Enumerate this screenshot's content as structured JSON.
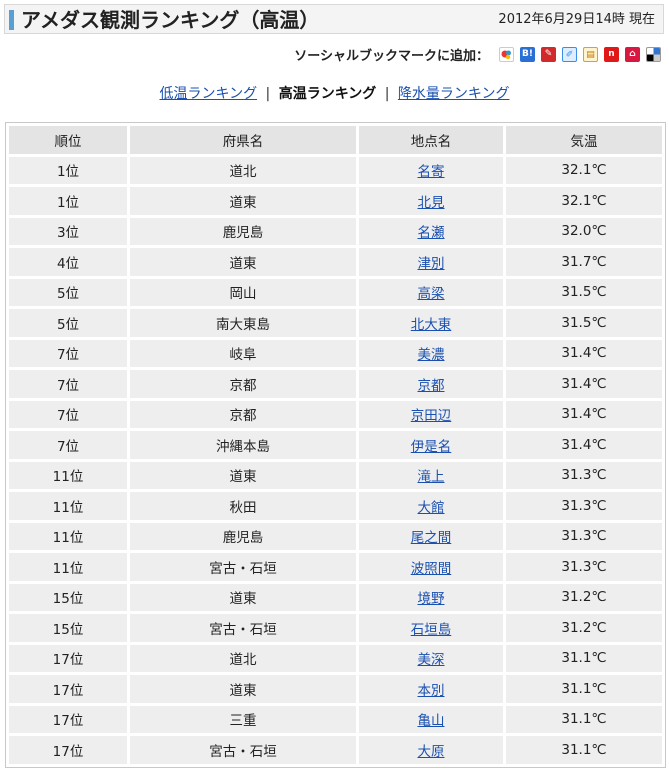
{
  "page": {
    "title": "アメダス観測ランキング（高温）",
    "timestamp": "2012年6月29日14時 現在"
  },
  "social": {
    "label": "ソーシャルブックマークに追加：",
    "icons": [
      {
        "name": "google-bookmark-icon",
        "color": "#ffffff"
      },
      {
        "name": "hatena-bookmark-icon",
        "color": "#2a6fd6"
      },
      {
        "name": "livedoor-clip-icon",
        "color": "#d22a2a"
      },
      {
        "name": "buzzurl-icon",
        "color": "#3a8ee6"
      },
      {
        "name": "yahoo-bookmark-icon",
        "color": "#f0b030"
      },
      {
        "name": "newsing-icon",
        "color": "#e01818"
      },
      {
        "name": "pookmark-icon",
        "color": "#d81840"
      },
      {
        "name": "delicious-icon",
        "color": "#3274d1"
      }
    ]
  },
  "nav": {
    "low_temp": "低温ランキング",
    "high_temp": "高温ランキング",
    "precip": "降水量ランキング",
    "separator": "|"
  },
  "table": {
    "headers": [
      "順位",
      "府県名",
      "地点名",
      "気温"
    ],
    "rows": [
      {
        "rank": "1位",
        "pref": "道北",
        "station": "名寄",
        "temp": "32.1℃"
      },
      {
        "rank": "1位",
        "pref": "道東",
        "station": "北見",
        "temp": "32.1℃"
      },
      {
        "rank": "3位",
        "pref": "鹿児島",
        "station": "名瀬",
        "temp": "32.0℃"
      },
      {
        "rank": "4位",
        "pref": "道東",
        "station": "津別",
        "temp": "31.7℃"
      },
      {
        "rank": "5位",
        "pref": "岡山",
        "station": "高梁",
        "temp": "31.5℃"
      },
      {
        "rank": "5位",
        "pref": "南大東島",
        "station": "北大東",
        "temp": "31.5℃"
      },
      {
        "rank": "7位",
        "pref": "岐阜",
        "station": "美濃",
        "temp": "31.4℃"
      },
      {
        "rank": "7位",
        "pref": "京都",
        "station": "京都",
        "temp": "31.4℃"
      },
      {
        "rank": "7位",
        "pref": "京都",
        "station": "京田辺",
        "temp": "31.4℃"
      },
      {
        "rank": "7位",
        "pref": "沖縄本島",
        "station": "伊是名",
        "temp": "31.4℃"
      },
      {
        "rank": "11位",
        "pref": "道東",
        "station": "滝上",
        "temp": "31.3℃"
      },
      {
        "rank": "11位",
        "pref": "秋田",
        "station": "大館",
        "temp": "31.3℃"
      },
      {
        "rank": "11位",
        "pref": "鹿児島",
        "station": "尾之間",
        "temp": "31.3℃"
      },
      {
        "rank": "11位",
        "pref": "宮古・石垣",
        "station": "波照間",
        "temp": "31.3℃"
      },
      {
        "rank": "15位",
        "pref": "道東",
        "station": "境野",
        "temp": "31.2℃"
      },
      {
        "rank": "15位",
        "pref": "宮古・石垣",
        "station": "石垣島",
        "temp": "31.2℃"
      },
      {
        "rank": "17位",
        "pref": "道北",
        "station": "美深",
        "temp": "31.1℃"
      },
      {
        "rank": "17位",
        "pref": "道東",
        "station": "本別",
        "temp": "31.1℃"
      },
      {
        "rank": "17位",
        "pref": "三重",
        "station": "亀山",
        "temp": "31.1℃"
      },
      {
        "rank": "17位",
        "pref": "宮古・石垣",
        "station": "大原",
        "temp": "31.1℃"
      }
    ]
  }
}
